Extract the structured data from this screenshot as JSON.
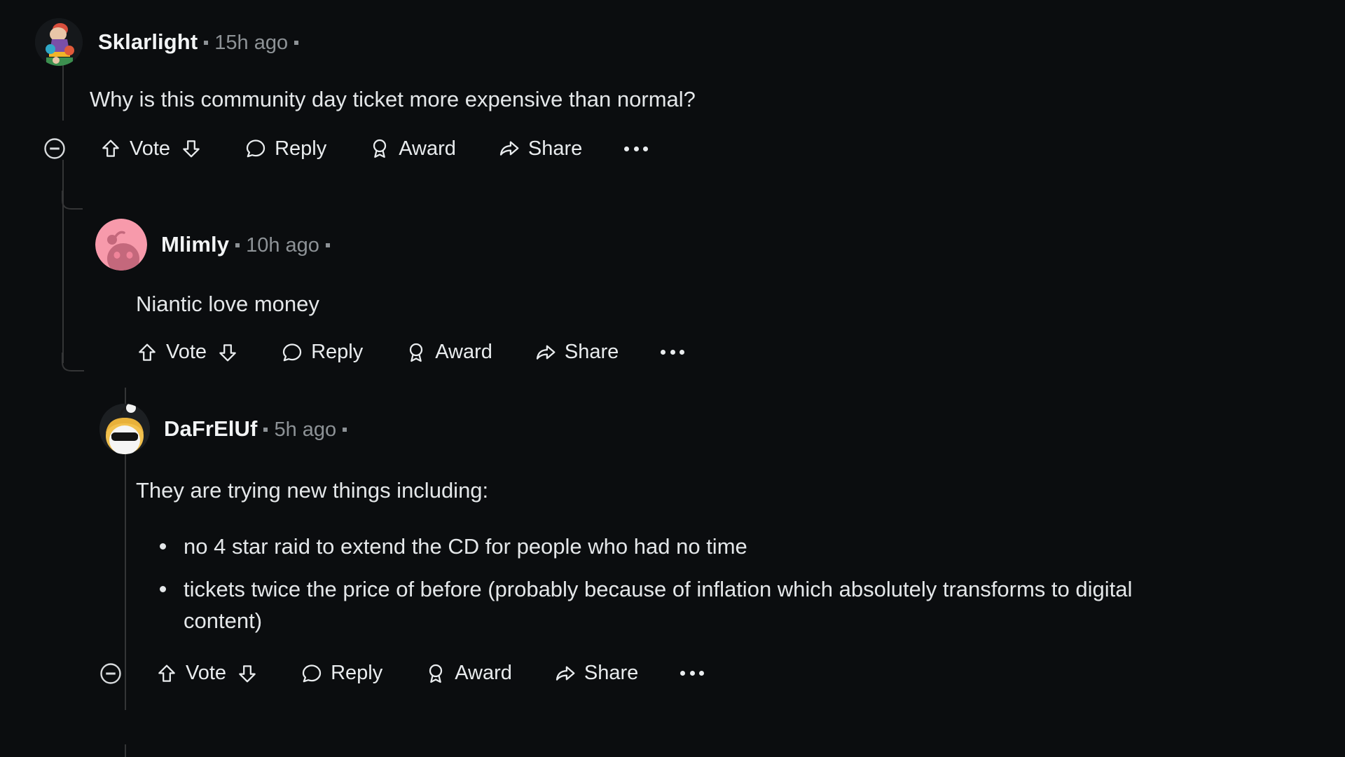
{
  "theme": {
    "background": "#0b0d0f",
    "text": "#e4e7e9",
    "muted": "#8d9296",
    "thread_line": "#343536"
  },
  "action_labels": {
    "vote": "Vote",
    "reply": "Reply",
    "award": "Award",
    "share": "Share",
    "more": "more-options"
  },
  "comments": [
    {
      "id": "comment-1",
      "author": "Sklarlight",
      "timestamp": "15h ago",
      "depth": 0,
      "avatar_type": "photo-avatar",
      "body": "Why is this community day ticket more expensive than normal?",
      "has_collapse": true,
      "actions": [
        "Vote",
        "Reply",
        "Award",
        "Share"
      ]
    },
    {
      "id": "comment-2",
      "author": "Mlimly",
      "timestamp": "10h ago",
      "depth": 1,
      "avatar_type": "snoo-pink-avatar",
      "body": "Niantic love money",
      "has_collapse": false,
      "actions": [
        "Vote",
        "Reply",
        "Award",
        "Share"
      ]
    },
    {
      "id": "comment-3",
      "author": "DaFrElUf",
      "timestamp": "5h ago",
      "depth": 1,
      "avatar_type": "snoo-sunglasses-avatar",
      "body": "They are trying new things including:",
      "bullets": [
        "no 4 star raid to extend the CD for people who had no time",
        "tickets twice the price of before (probably because of inflation which absolutely transforms to digital content)"
      ],
      "has_collapse": true,
      "actions": [
        "Vote",
        "Reply",
        "Award",
        "Share"
      ]
    }
  ]
}
